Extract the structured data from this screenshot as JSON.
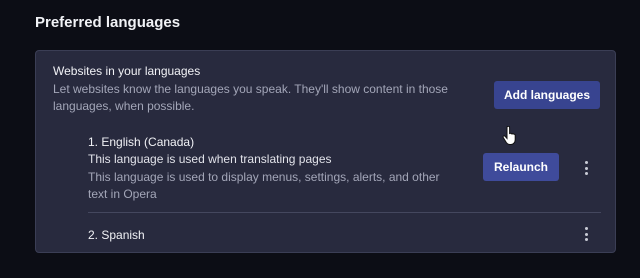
{
  "section": {
    "title": "Preferred languages"
  },
  "card": {
    "title": "Websites in your languages",
    "description": "Let websites know the languages you speak. They'll show content in those languages, when possible.",
    "add_button_label": "Add languages"
  },
  "languages": [
    {
      "name": "1. English (Canada)",
      "note_translate": "This language is used when translating pages",
      "note_display": "This language is used to display menus, settings, alerts, and other text in Opera",
      "relaunch_label": "Relaunch",
      "menu_icon": "more-vert-icon"
    },
    {
      "name": "2. Spanish",
      "menu_icon": "more-vert-icon"
    }
  ],
  "colors": {
    "page_background": "#0c0d15",
    "card_background": "#282a3e",
    "button_background": "#384490",
    "secondary_text": "#a3a6b8"
  }
}
